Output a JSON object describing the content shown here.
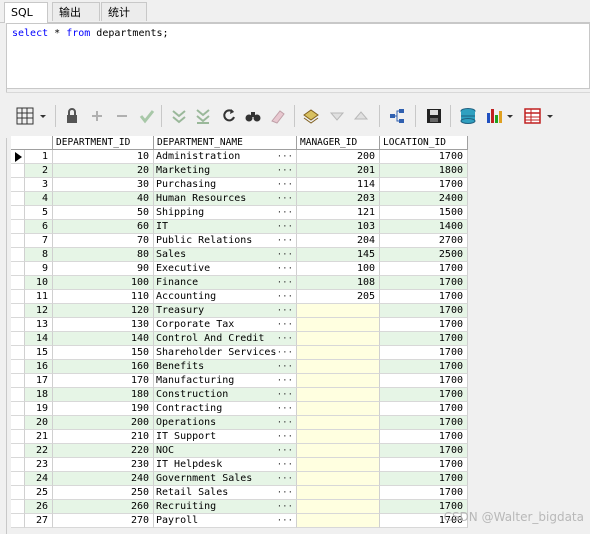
{
  "tabs": [
    {
      "label": "SQL"
    },
    {
      "label": "输出"
    },
    {
      "label": "统计"
    }
  ],
  "editor": {
    "kw_select": "select",
    "star": " * ",
    "kw_from": "from",
    "rest": " departments;"
  },
  "columns": [
    "DEPARTMENT_ID",
    "DEPARTMENT_NAME",
    "MANAGER_ID",
    "LOCATION_ID"
  ],
  "rows": [
    {
      "n": "1",
      "id": "10",
      "name": "Administration",
      "mgr": "200",
      "loc": "1700"
    },
    {
      "n": "2",
      "id": "20",
      "name": "Marketing",
      "mgr": "201",
      "loc": "1800"
    },
    {
      "n": "3",
      "id": "30",
      "name": "Purchasing",
      "mgr": "114",
      "loc": "1700"
    },
    {
      "n": "4",
      "id": "40",
      "name": "Human Resources",
      "mgr": "203",
      "loc": "2400"
    },
    {
      "n": "5",
      "id": "50",
      "name": "Shipping",
      "mgr": "121",
      "loc": "1500"
    },
    {
      "n": "6",
      "id": "60",
      "name": "IT",
      "mgr": "103",
      "loc": "1400"
    },
    {
      "n": "7",
      "id": "70",
      "name": "Public Relations",
      "mgr": "204",
      "loc": "2700"
    },
    {
      "n": "8",
      "id": "80",
      "name": "Sales",
      "mgr": "145",
      "loc": "2500"
    },
    {
      "n": "9",
      "id": "90",
      "name": "Executive",
      "mgr": "100",
      "loc": "1700"
    },
    {
      "n": "10",
      "id": "100",
      "name": "Finance",
      "mgr": "108",
      "loc": "1700"
    },
    {
      "n": "11",
      "id": "110",
      "name": "Accounting",
      "mgr": "205",
      "loc": "1700"
    },
    {
      "n": "12",
      "id": "120",
      "name": "Treasury",
      "mgr": "",
      "loc": "1700"
    },
    {
      "n": "13",
      "id": "130",
      "name": "Corporate Tax",
      "mgr": "",
      "loc": "1700"
    },
    {
      "n": "14",
      "id": "140",
      "name": "Control And Credit",
      "mgr": "",
      "loc": "1700"
    },
    {
      "n": "15",
      "id": "150",
      "name": "Shareholder Services",
      "mgr": "",
      "loc": "1700"
    },
    {
      "n": "16",
      "id": "160",
      "name": "Benefits",
      "mgr": "",
      "loc": "1700"
    },
    {
      "n": "17",
      "id": "170",
      "name": "Manufacturing",
      "mgr": "",
      "loc": "1700"
    },
    {
      "n": "18",
      "id": "180",
      "name": "Construction",
      "mgr": "",
      "loc": "1700"
    },
    {
      "n": "19",
      "id": "190",
      "name": "Contracting",
      "mgr": "",
      "loc": "1700"
    },
    {
      "n": "20",
      "id": "200",
      "name": "Operations",
      "mgr": "",
      "loc": "1700"
    },
    {
      "n": "21",
      "id": "210",
      "name": "IT Support",
      "mgr": "",
      "loc": "1700"
    },
    {
      "n": "22",
      "id": "220",
      "name": "NOC",
      "mgr": "",
      "loc": "1700"
    },
    {
      "n": "23",
      "id": "230",
      "name": "IT Helpdesk",
      "mgr": "",
      "loc": "1700"
    },
    {
      "n": "24",
      "id": "240",
      "name": "Government Sales",
      "mgr": "",
      "loc": "1700"
    },
    {
      "n": "25",
      "id": "250",
      "name": "Retail Sales",
      "mgr": "",
      "loc": "1700"
    },
    {
      "n": "26",
      "id": "260",
      "name": "Recruiting",
      "mgr": "",
      "loc": "1700"
    },
    {
      "n": "27",
      "id": "270",
      "name": "Payroll",
      "mgr": "",
      "loc": "1700"
    }
  ],
  "ellipsis": "···",
  "watermark": "CSDN @Walter_bigdata",
  "colors": {
    "even_row": "#e6f5e6",
    "odd_row": "#ffffff",
    "null_cell": "#ffffe0",
    "selected_marker": "#000000"
  }
}
